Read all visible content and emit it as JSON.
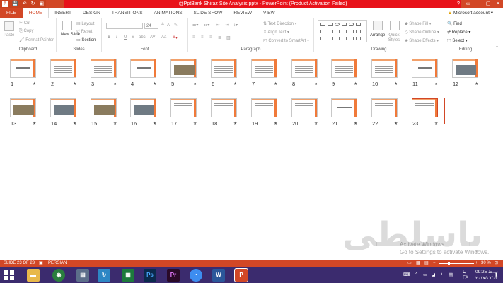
{
  "window": {
    "title": "@PptBank Shiraz Site Analysis.pptx - PowerPoint (Product Activation Failed)",
    "controls": [
      "?",
      "▭",
      "—",
      "▢",
      "✕"
    ]
  },
  "qat": {
    "save": "💾",
    "undo": "↶",
    "redo": "↻",
    "present": "▣"
  },
  "tabs": [
    "FILE",
    "HOME",
    "INSERT",
    "DESIGN",
    "TRANSITIONS",
    "ANIMATIONS",
    "SLIDE SHOW",
    "REVIEW",
    "VIEW"
  ],
  "account": "Microsoft account",
  "ribbon": {
    "clipboard": {
      "label": "Clipboard",
      "paste": "Paste",
      "cut": "Cut",
      "copy": "Copy",
      "format_painter": "Format Painter"
    },
    "slides": {
      "label": "Slides",
      "new_slide": "New Slide",
      "layout": "Layout",
      "reset": "Reset",
      "section": "Section"
    },
    "font": {
      "label": "Font",
      "font_name": "",
      "font_size": "24",
      "bold": "B",
      "italic": "I",
      "underline": "U",
      "strike": "S",
      "abc": "abc",
      "av": "AV",
      "aa": "Aa",
      "grow": "A",
      "shrink": "A"
    },
    "paragraph": {
      "label": "Paragraph",
      "text_direction": "Text Direction",
      "align_text": "Align Text",
      "smartart": "Convert to SmartArt"
    },
    "drawing": {
      "label": "Drawing",
      "arrange": "Arrange",
      "quick_styles": "Quick Styles",
      "shape_fill": "Shape Fill",
      "shape_outline": "Shape Outline",
      "shape_effects": "Shape Effects"
    },
    "editing": {
      "label": "Editing",
      "find": "Find",
      "replace": "Replace",
      "select": "Select"
    }
  },
  "slides_row1": [
    "1",
    "2",
    "3",
    "4",
    "5",
    "6",
    "7",
    "8",
    "9",
    "10",
    "11",
    "12"
  ],
  "slides_row2": [
    "13",
    "14",
    "15",
    "16",
    "17",
    "18",
    "19",
    "20",
    "21",
    "22",
    "23"
  ],
  "star": "★",
  "watermark": "باسلطی",
  "activate": {
    "line1": "Activate Windows",
    "line2": "Go to Settings to activate Windows."
  },
  "status": {
    "slide": "SLIDE 23 OF 23",
    "language": "PERSIAN",
    "zoom": "30 %"
  },
  "taskbar": {
    "lang": "FA",
    "time": "09:25 ب.ظ",
    "date": "۲۰۱۷/۰۷/۰۳",
    "day": "ما"
  }
}
